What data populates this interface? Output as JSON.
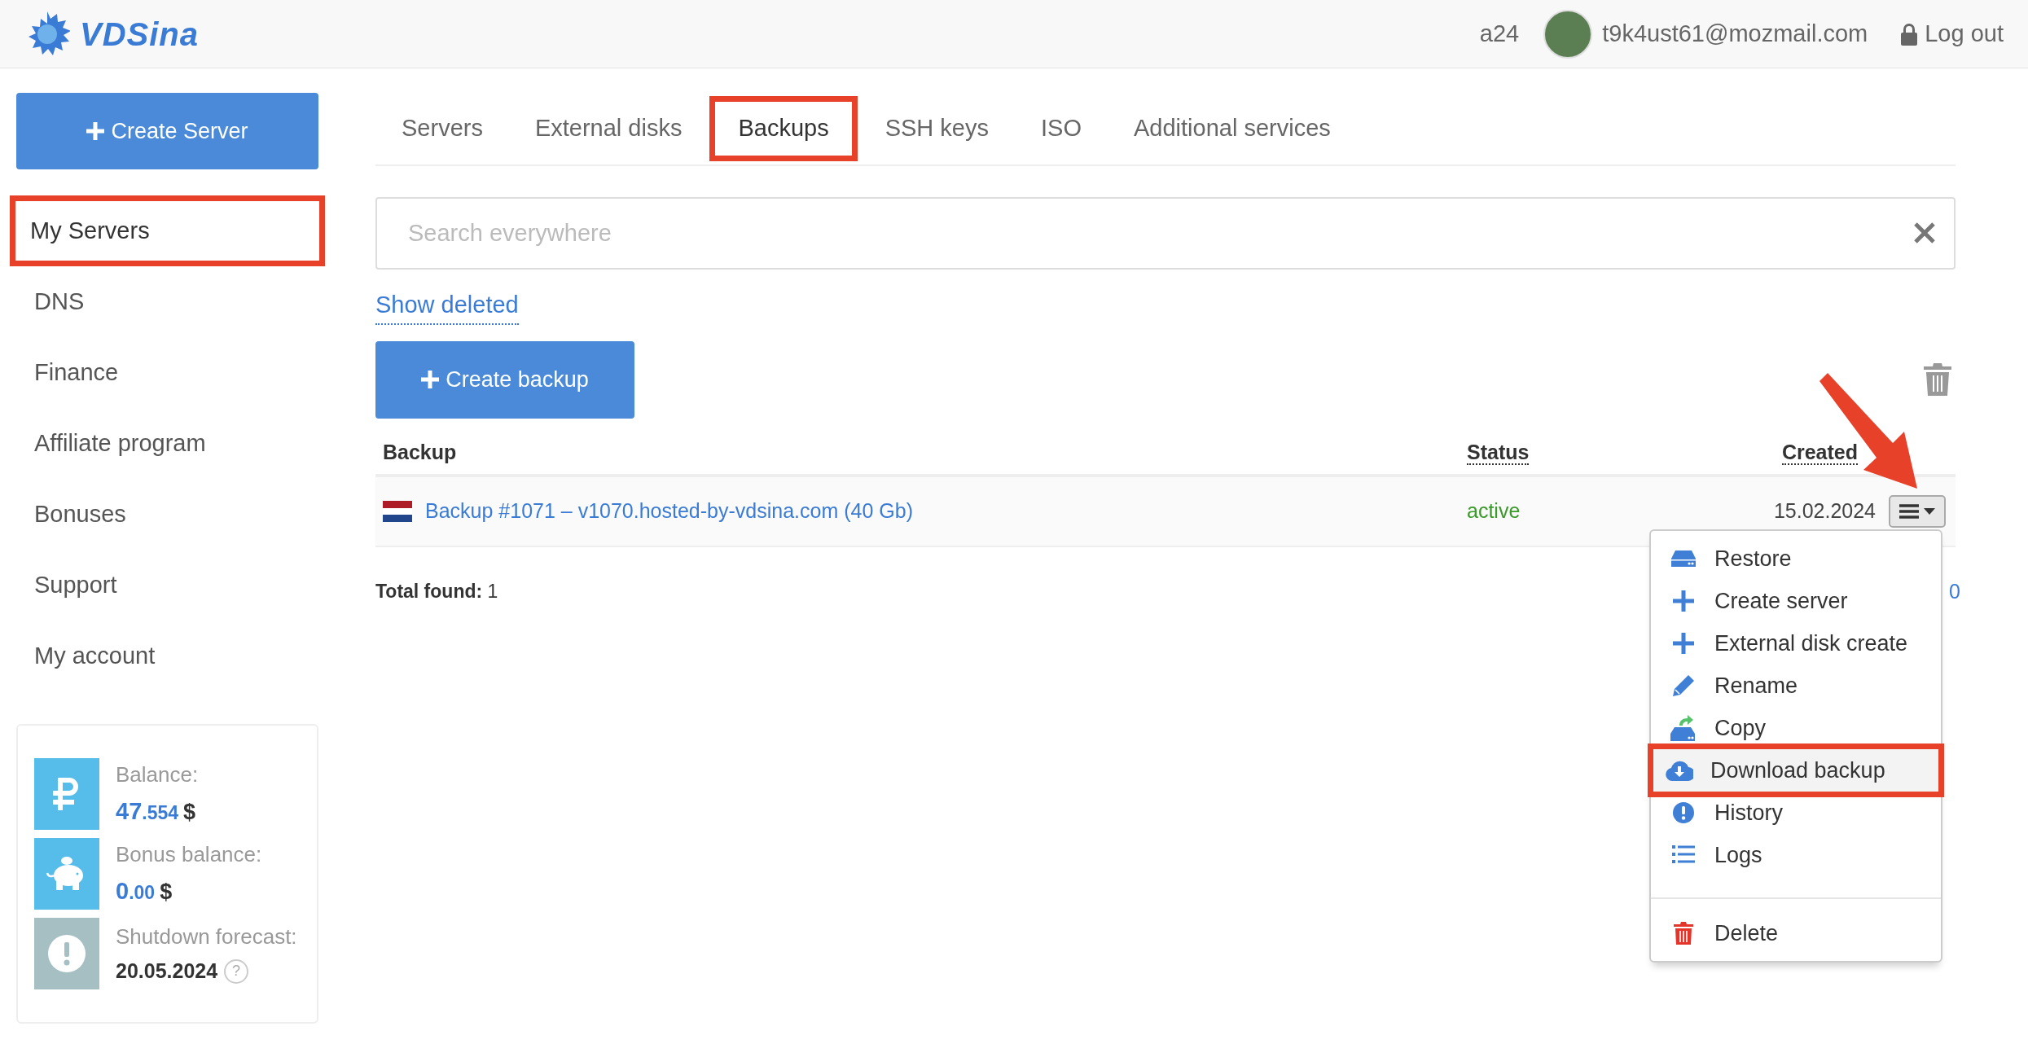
{
  "header": {
    "logo_text": "VDSina",
    "account_id": "a24",
    "email": "t9k4ust61@mozmail.com",
    "logout": "Log out"
  },
  "sidebar": {
    "create_button": "Create Server",
    "items": [
      {
        "label": "My Servers",
        "selected": true,
        "highlighted": true
      },
      {
        "label": "DNS",
        "selected": false,
        "highlighted": false
      },
      {
        "label": "Finance",
        "selected": false,
        "highlighted": false
      },
      {
        "label": "Affiliate program",
        "selected": false,
        "highlighted": false
      },
      {
        "label": "Bonuses",
        "selected": false,
        "highlighted": false
      },
      {
        "label": "Support",
        "selected": false,
        "highlighted": false
      },
      {
        "label": "My account",
        "selected": false,
        "highlighted": false
      }
    ],
    "balance_card": [
      {
        "kind": "ruble",
        "label": "Balance:",
        "integer": "47",
        "fraction": ".554",
        "currency": "$"
      },
      {
        "kind": "piggy",
        "label": "Bonus balance:",
        "integer": "0",
        "fraction": ".00",
        "currency": "$"
      },
      {
        "kind": "forecast",
        "label": "Shutdown forecast:",
        "date": "20.05.2024",
        "help": "?"
      }
    ]
  },
  "tabs": [
    {
      "label": "Servers",
      "selected": false,
      "highlighted": false
    },
    {
      "label": "External disks",
      "selected": false,
      "highlighted": false
    },
    {
      "label": "Backups",
      "selected": true,
      "highlighted": true
    },
    {
      "label": "SSH keys",
      "selected": false,
      "highlighted": false
    },
    {
      "label": "ISO",
      "selected": false,
      "highlighted": false
    },
    {
      "label": "Additional services",
      "selected": false,
      "highlighted": false
    }
  ],
  "search": {
    "placeholder": "Search everywhere"
  },
  "show_deleted": "Show deleted",
  "create_backup": "Create backup",
  "table": {
    "columns": [
      {
        "label": "Backup",
        "sortable": false
      },
      {
        "label": "Status",
        "sortable": true
      },
      {
        "label": "Created",
        "sortable": true
      }
    ],
    "rows": [
      {
        "name": "Backup #1071 – v1070.hosted-by-vdsina.com (40 Gb)",
        "status": "active",
        "created": "15.02.2024"
      }
    ]
  },
  "total_found": {
    "label": "Total found:",
    "value": "1"
  },
  "pagination_partial": "0",
  "menu": {
    "groups": [
      [
        {
          "kind": "restore",
          "label": "Restore",
          "highlighted": false
        },
        {
          "kind": "plus",
          "label": "Create server",
          "highlighted": false
        },
        {
          "kind": "plus",
          "label": "External disk create",
          "highlighted": false
        },
        {
          "kind": "rename",
          "label": "Rename",
          "highlighted": false
        },
        {
          "kind": "copy",
          "label": "Copy",
          "highlighted": false
        },
        {
          "kind": "download",
          "label": "Download backup",
          "highlighted": true
        },
        {
          "kind": "history",
          "label": "History",
          "highlighted": false
        },
        {
          "kind": "logs",
          "label": "Logs",
          "highlighted": false
        }
      ],
      [
        {
          "kind": "delete",
          "label": "Delete",
          "highlighted": false
        }
      ]
    ]
  }
}
